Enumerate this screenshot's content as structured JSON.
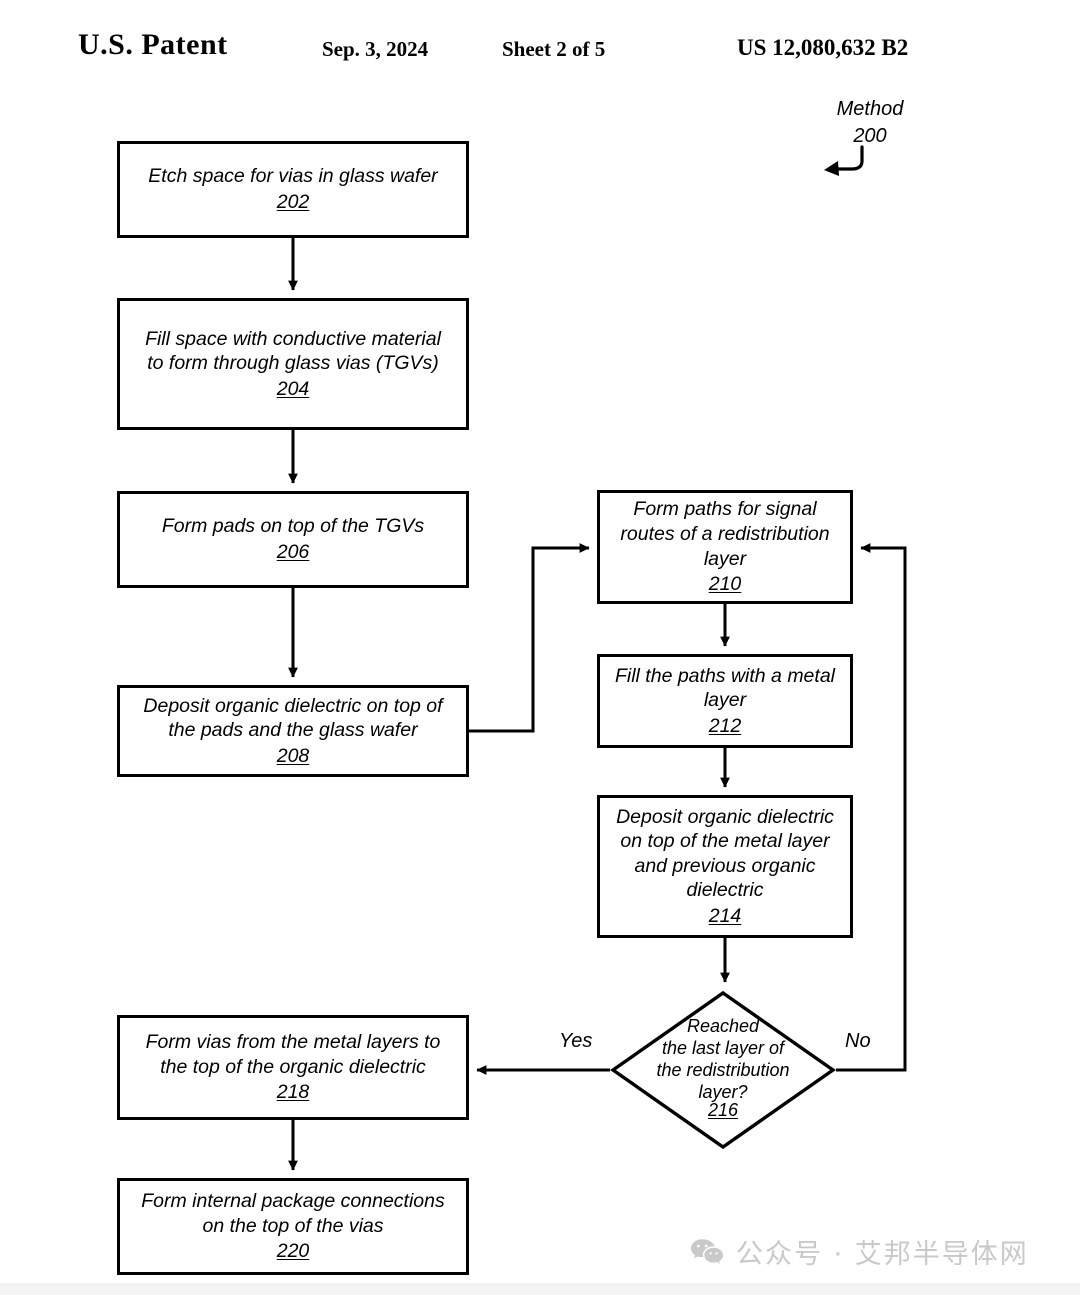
{
  "header": {
    "patent_label": "U.S. Patent",
    "date": "Sep. 3, 2024",
    "sheet": "Sheet 2 of 5",
    "patent_number": "US 12,080,632 B2"
  },
  "figure": {
    "method_label": "Method\n200",
    "diagram_type": "flowchart",
    "nodes": [
      {
        "id": "202",
        "shape": "process",
        "text": "Etch space for vias in glass wafer",
        "ref": "202"
      },
      {
        "id": "204",
        "shape": "process",
        "text": "Fill space with conductive material\nto form through glass vias (TGVs)",
        "ref": "204"
      },
      {
        "id": "206",
        "shape": "process",
        "text": "Form pads on top of the TGVs",
        "ref": "206"
      },
      {
        "id": "208",
        "shape": "process",
        "text": "Deposit organic dielectric on top of\nthe pads and the glass wafer",
        "ref": "208"
      },
      {
        "id": "210",
        "shape": "process",
        "text": "Form paths for signal\nroutes of a redistribution\nlayer",
        "ref": "210"
      },
      {
        "id": "212",
        "shape": "process",
        "text": "Fill the paths with a metal\nlayer",
        "ref": "212"
      },
      {
        "id": "214",
        "shape": "process",
        "text": "Deposit organic dielectric\non top of the metal layer\nand previous organic\ndielectric",
        "ref": "214"
      },
      {
        "id": "216",
        "shape": "decision",
        "text": "Reached\nthe last layer of\nthe redistribution\nlayer?",
        "ref": "216"
      },
      {
        "id": "218",
        "shape": "process",
        "text": "Form vias from the metal layers to\nthe top of the organic dielectric",
        "ref": "218"
      },
      {
        "id": "220",
        "shape": "process",
        "text": "Form internal package connections\non the top of the vias",
        "ref": "220"
      }
    ],
    "edges": [
      {
        "from": "202",
        "to": "204",
        "label": ""
      },
      {
        "from": "204",
        "to": "206",
        "label": ""
      },
      {
        "from": "206",
        "to": "208",
        "label": ""
      },
      {
        "from": "208",
        "to": "210",
        "label": ""
      },
      {
        "from": "210",
        "to": "212",
        "label": ""
      },
      {
        "from": "212",
        "to": "214",
        "label": ""
      },
      {
        "from": "214",
        "to": "216",
        "label": ""
      },
      {
        "from": "216",
        "to": "218",
        "label": "Yes"
      },
      {
        "from": "216",
        "to": "210",
        "label": "No"
      },
      {
        "from": "218",
        "to": "220",
        "label": ""
      }
    ],
    "edge_labels": {
      "yes": "Yes",
      "no": "No"
    }
  },
  "watermark": {
    "text": "公众号 · 艾邦半导体网",
    "icon": "wechat-icon",
    "color": "#c9c9c9"
  },
  "colors": {
    "ink": "#000000",
    "page": "#ffffff",
    "watermark": "#c9c9c9"
  }
}
